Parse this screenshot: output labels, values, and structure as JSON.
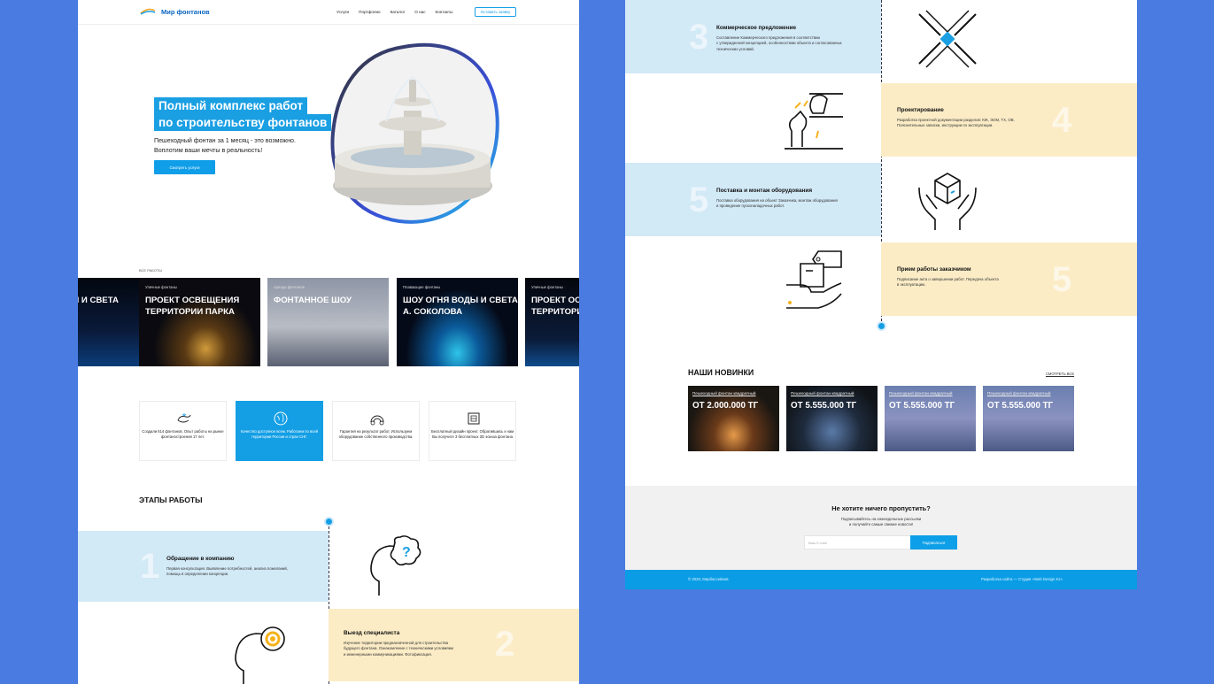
{
  "colors": {
    "background": "#4a7be0",
    "accent": "#149fe5",
    "stage_blue": "#d2e9f6",
    "stage_cream": "#fbecc6"
  },
  "header": {
    "logo_text": "Мир фонтанов",
    "nav": [
      "Услуги",
      "Портфолио",
      "Каталог",
      "О нас",
      "Контакты"
    ],
    "cta": "Оставить заявку"
  },
  "hero": {
    "title_line1": "Полный комплекс работ",
    "title_line2": "по строительству фонтанов",
    "subtitle_line1": "Пешеходный фонтан за 1 месяц - это возможно.",
    "subtitle_line2": "Воплотим ваши мечты в реальность!",
    "button": "Смотреть услуги"
  },
  "works": {
    "label": "ВСЕ РАБОТЫ",
    "cards": [
      {
        "category": "",
        "title": "ДЫ И СВЕТА"
      },
      {
        "category": "Уличные фонтаны",
        "title": "ПРОЕКТ ОСВЕЩЕНИЯ\nТЕРРИТОРИИ ПАРКА"
      },
      {
        "category": "Аренда фонтанов",
        "title": "ФОНТАННОЕ ШОУ"
      },
      {
        "category": "Плавающие фонтаны",
        "title": "ШОУ ОГНЯ ВОДЫ И СВЕТА\nА. СОКОЛОВА"
      },
      {
        "category": "Уличные фонтаны",
        "title": "ПРОЕКТ ОСВЕ\nТЕРРИТОРИ"
      }
    ]
  },
  "features": [
    {
      "icon": "whale-icon",
      "text": "Создали 614 фонтанов. Опыт работы на рынке фонтаностроения 17 лет."
    },
    {
      "icon": "globe-icon",
      "text": "Качество доступное всем. Работаем по всей территории России и стран СНГ."
    },
    {
      "icon": "rainbow-icon",
      "text": "Гарантия на результат работ. Используем оборудование собственного производства."
    },
    {
      "icon": "blueprint-icon",
      "text": "Бесплатный дизайн проект. Обратившись к нам Вы получите 3 бесплатных 3D эскиза фонтана"
    }
  ],
  "stages": {
    "title": "ЭТАПЫ РАБОТЫ",
    "items": [
      {
        "num": "1",
        "title": "Обращение в компанию",
        "desc": "Первая консультация. Выявление потребностей, анализ пожеланий,\nпомощь в определении концепции.",
        "icon": "head-question-icon"
      },
      {
        "num": "2",
        "title": "Выезд специалиста",
        "desc": "Изучение территории предназначенной для строительства\nбудущего фонтана. Ознакомление с техническими условиями\nи инженерными коммуникациями. Фотофиксация.",
        "icon": "head-gear-icon"
      },
      {
        "num": "3",
        "title": "Коммерческое предложение",
        "desc": "Составление Коммерческого предложения в соответствии\nс утвержденной концепцией, особенностями объекта и согласованных\nтехнических условий.",
        "icon": "handshake-icon"
      },
      {
        "num": "4",
        "title": "Проектирование",
        "desc": "Разработка проектной документации разделов: КЖ, ЭОМ, ТХ, ОВ.\nПояснительные записки, инструкции по эксплуатации.",
        "icon": "chess-icon"
      },
      {
        "num": "5",
        "title": "Поставка и монтаж оборудования",
        "desc": "Поставка оборудования на объект Заказчика, монтаж оборудования\nи проведение пусконаладочных работ.",
        "icon": "box-hands-icon"
      },
      {
        "num": "5",
        "title": "Прием работы заказчиком",
        "desc": "Подписание акта о завершении работ. Передача объекта\nв эксплуатацию.",
        "icon": "hand-tag-icon"
      }
    ]
  },
  "news": {
    "title": "НАШИ НОВИНКИ",
    "see_all": "СМОТРЕТЬ ВСЕ",
    "products": [
      {
        "label": "Пешеходный фонтан квадратный",
        "price": "ОТ 2.000.000 ТГ"
      },
      {
        "label": "Пешеходный фонтан квадратный",
        "price": "ОТ 5.555.000 ТГ"
      },
      {
        "label": "Пешеходный фонтан квадратный",
        "price": "ОТ 5.555.000 ТГ"
      },
      {
        "label": "Пешеходный фонтан квадратный",
        "price": "ОТ 5.555.000 ТГ"
      }
    ]
  },
  "subscribe": {
    "title": "Не хотите ничего пропустить?",
    "desc": "Подписывайтесь на еженедельные рассылки\nи получайте самые свежие новости!",
    "placeholder": "Ваш E-mail",
    "button": "Подписаться"
  },
  "footer": {
    "copyright": "© 2020, Мирбассейнов",
    "dev": "Разработка сайта — Студия «Web Design Kz»"
  }
}
